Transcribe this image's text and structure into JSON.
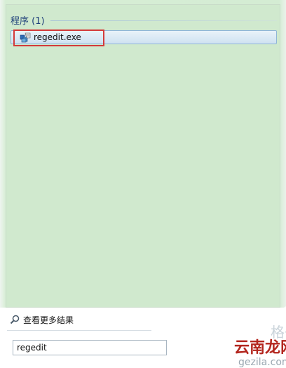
{
  "results": {
    "group_title": "程序 (1)",
    "item_label": "regedit.exe",
    "item_icon": "registry-editor-icon"
  },
  "footer": {
    "more_results_label": "查看更多结果",
    "search_icon": "search-icon",
    "search_value": "regedit"
  },
  "colors": {
    "results_bg": "#d0e9ce",
    "highlight_border": "#d43a3a",
    "group_title": "#1e3f7a"
  },
  "watermark": {
    "site_name": "云南龙网",
    "domain_text": "gezila.com",
    "brand": "格子啦"
  }
}
